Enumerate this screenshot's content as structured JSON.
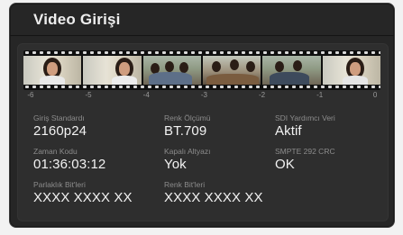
{
  "panel": {
    "title": "Video Girişi"
  },
  "timeline": {
    "ticks": [
      "-6",
      "-5",
      "-4",
      "-3",
      "-2",
      "-1",
      "0"
    ]
  },
  "fields": {
    "input_standard": {
      "label": "Giriş Standardı",
      "value": "2160p24"
    },
    "color_space": {
      "label": "Renk Ölçümü",
      "value": "BT.709"
    },
    "sdi_ancillary": {
      "label": "SDI Yardımcı Veri",
      "value": "Aktif"
    },
    "timecode": {
      "label": "Zaman Kodu",
      "value": "01:36:03:12"
    },
    "closed_captions": {
      "label": "Kapalı Altyazı",
      "value": "Yok"
    },
    "smpte_crc": {
      "label": "SMPTE 292 CRC",
      "value": "OK"
    },
    "brightness_bits": {
      "label": "Parlaklık Bit'leri",
      "value": "XXXX XXXX XX"
    },
    "color_bits": {
      "label": "Renk Bit'leri",
      "value": "XXXX XXXX XX"
    }
  }
}
